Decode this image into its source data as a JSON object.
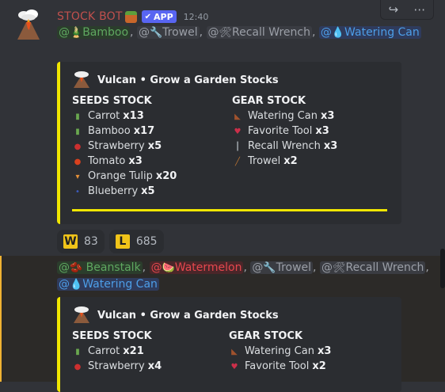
{
  "message1": {
    "author": "STOCK BOT",
    "badge": "APP",
    "badge_check": "✔",
    "time": "12:40",
    "mentions": [
      {
        "text": "Bamboo",
        "style": "green",
        "icon": "🎍"
      },
      {
        "text": "Trowel",
        "style": "gray",
        "icon": "🔧"
      },
      {
        "text": "Recall Wrench",
        "style": "gray",
        "icon": "🛠"
      },
      {
        "text": "Watering Can",
        "style": "blue",
        "icon": "💧"
      }
    ],
    "embed": {
      "author": "Vulcan • Grow a Garden Stocks",
      "seeds_title": "SEEDS STOCK",
      "gear_title": "GEAR STOCK",
      "seeds": [
        {
          "name": "Carrot",
          "qty": "x13",
          "color": "#6aa84f"
        },
        {
          "name": "Bamboo",
          "qty": "x17",
          "color": "#6aa84f"
        },
        {
          "name": "Strawberry",
          "qty": "x5",
          "color": "#cc2f2f"
        },
        {
          "name": "Tomato",
          "qty": "x3",
          "color": "#d9411e"
        },
        {
          "name": "Orange Tulip",
          "qty": "x20",
          "color": "#e69138"
        },
        {
          "name": "Blueberry",
          "qty": "x5",
          "color": "#3d5bbd"
        }
      ],
      "gear": [
        {
          "name": "Watering Can",
          "qty": "x3",
          "color": "#a0522d"
        },
        {
          "name": "Favorite Tool",
          "qty": "x3",
          "color": "#cc2f4a"
        },
        {
          "name": "Recall Wrench",
          "qty": "x3",
          "color": "#9aa0a6"
        },
        {
          "name": "Trowel",
          "qty": "x2",
          "color": "#b87333"
        }
      ]
    },
    "reactions": [
      {
        "emoji": "W",
        "count": "83"
      },
      {
        "emoji": "L",
        "count": "685"
      }
    ]
  },
  "message2": {
    "mentions": [
      {
        "text": "Beanstalk",
        "style": "green",
        "icon": "🫘"
      },
      {
        "text": "Watermelon",
        "style": "red",
        "icon": "🍉"
      },
      {
        "text": "Trowel",
        "style": "gray",
        "icon": "🔧"
      },
      {
        "text": "Recall Wrench",
        "style": "gray",
        "icon": "🛠"
      },
      {
        "text": "Watering Can",
        "style": "blue",
        "icon": "💧"
      }
    ],
    "embed": {
      "author": "Vulcan • Grow a Garden Stocks",
      "seeds_title": "SEEDS STOCK",
      "gear_title": "GEAR STOCK",
      "seeds": [
        {
          "name": "Carrot",
          "qty": "x21",
          "color": "#6aa84f"
        },
        {
          "name": "Strawberry",
          "qty": "x4",
          "color": "#cc2f2f"
        }
      ],
      "gear": [
        {
          "name": "Watering Can",
          "qty": "x3",
          "color": "#a0522d"
        },
        {
          "name": "Favorite Tool",
          "qty": "x2",
          "color": "#cc2f4a"
        }
      ]
    }
  },
  "hover_icons": [
    "reply-icon",
    "more-icon"
  ]
}
